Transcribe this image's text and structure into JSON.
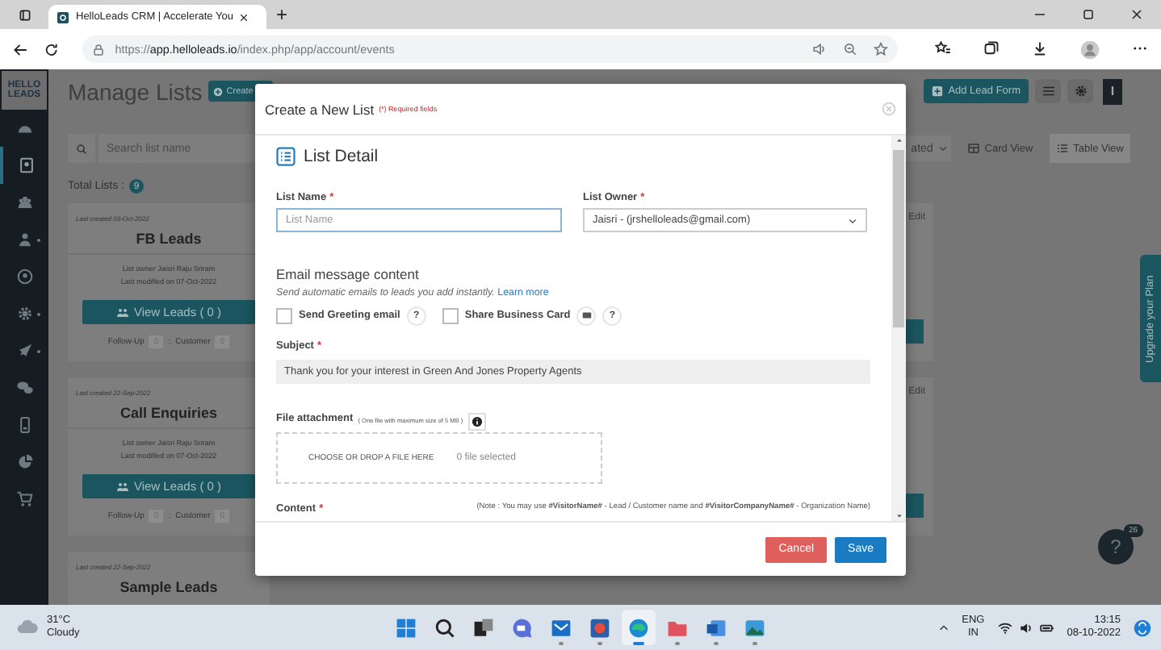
{
  "browser": {
    "tab": {
      "title": "HelloLeads CRM | Accelerate You",
      "selected": true
    },
    "new_tab": "+",
    "url": {
      "scheme": "https://",
      "host": "app.helloleads.io",
      "path": "/index.php/app/account/events"
    }
  },
  "sidebar": {
    "logo": [
      "HELLO",
      "LEADS"
    ],
    "items": [
      {
        "kind": "gauge",
        "selected": false,
        "expandable": false
      },
      {
        "kind": "contacts",
        "selected": true,
        "expandable": false
      },
      {
        "kind": "team",
        "selected": false,
        "expandable": false
      },
      {
        "kind": "user-add",
        "selected": false,
        "expandable": true
      },
      {
        "kind": "user",
        "selected": false,
        "expandable": false
      },
      {
        "kind": "gear",
        "selected": false,
        "expandable": true
      },
      {
        "kind": "rocket",
        "selected": false,
        "expandable": true
      },
      {
        "kind": "chat",
        "selected": false,
        "expandable": false
      },
      {
        "kind": "phone",
        "selected": false,
        "expandable": false
      },
      {
        "kind": "pie",
        "selected": false,
        "expandable": false
      },
      {
        "kind": "cart",
        "selected": false,
        "expandable": false
      }
    ]
  },
  "page": {
    "title": "Manage Lists",
    "create_button": "Create",
    "add_lead_form_button": "Add Lead Form",
    "user_initial": "I",
    "search": {
      "placeholder": "Search list name"
    },
    "sort": {
      "value": "ated"
    },
    "views": [
      {
        "label": "Card View",
        "kind": "card",
        "selected": false
      },
      {
        "label": "Table View",
        "kind": "table",
        "selected": true
      }
    ],
    "total_lists": {
      "label": "Total Lists :",
      "count": "9"
    },
    "cards": [
      {
        "created": "Last created 03-Oct-2022",
        "name": "FB Leads",
        "owner": "List owner Jaisri Raju Sriram",
        "modified": "Last modified on 07-Oct-2022",
        "view_button": "View Leads ( 0 )",
        "follow_up_label": "Follow-Up",
        "follow_up_count": "0",
        "separator": ":",
        "customer_label": "Customer",
        "customer_count": "0"
      },
      {
        "created": "Last created 22-Sep-2022",
        "name": "Call Enquiries",
        "owner": "List owner Jaisri Raju Sriram",
        "modified": "Last modified on 07-Oct-2022",
        "view_button": "View Leads ( 0 )",
        "follow_up_label": "Follow-Up",
        "follow_up_count": "0",
        "separator": ":",
        "customer_label": "Customer",
        "customer_count": "0"
      },
      {
        "created": "Last created 22-Sep-2022",
        "name": "Sample Leads"
      }
    ],
    "right_cards": [
      {
        "edit": "Edit"
      },
      {
        "edit": "Edit"
      }
    ],
    "upgrade_tab": "Upgrade your Plan",
    "help": {
      "label": "?",
      "badge": "26"
    }
  },
  "modal": {
    "title": "Create a New List",
    "required_note": "(*) Required fields",
    "section_title": "List Detail",
    "list_name": {
      "label": "List Name",
      "mark": "*",
      "placeholder": "List Name"
    },
    "list_owner": {
      "label": "List Owner",
      "mark": "*",
      "value": "Jaisri - (jrshelloleads@gmail.com)"
    },
    "email_heading": "Email message content",
    "email_hint": "Send automatic emails to leads you add instantly.",
    "learn_more": "Learn more",
    "options": [
      {
        "label": "Send Greeting email",
        "kind": "plain",
        "checked": false,
        "help": "?"
      },
      {
        "label": "Share Business Card",
        "kind": "card",
        "checked": false,
        "help": "?"
      }
    ],
    "subject": {
      "label": "Subject",
      "mark": "*",
      "value": "Thank you for your interest in Green And Jones Property Agents"
    },
    "attachment": {
      "label": "File attachment",
      "hint": "( One file with maximum size of 5 MB )",
      "drop_text": "CHOOSE OR DROP A FILE HERE",
      "status": "0 file selected"
    },
    "content": {
      "label": "Content",
      "mark": "*",
      "note": "(Note : You may use **#VisitorName#** - Lead / Customer name and **#VisitorCompanyName#** - Organization Name)"
    },
    "buttons": [
      {
        "label": "Cancel",
        "kind": "cancel"
      },
      {
        "label": "Save",
        "kind": "primary"
      }
    ]
  },
  "taskbar": {
    "weather": {
      "temp": "31°C",
      "condition": "Cloudy"
    },
    "apps": [
      {
        "kind": "start",
        "running": false,
        "selected": false
      },
      {
        "kind": "search",
        "running": false,
        "selected": false
      },
      {
        "kind": "task-view",
        "running": false,
        "selected": false
      },
      {
        "kind": "chat",
        "running": false,
        "selected": false
      },
      {
        "kind": "mail",
        "running": true,
        "selected": false
      },
      {
        "kind": "app",
        "running": true,
        "selected": false
      },
      {
        "kind": "browser",
        "running": true,
        "selected": true
      },
      {
        "kind": "folder",
        "running": true,
        "selected": false
      },
      {
        "kind": "word",
        "running": true,
        "selected": false
      },
      {
        "kind": "photos",
        "running": true,
        "selected": false
      }
    ],
    "language": [
      "ENG",
      "IN"
    ],
    "time": "13:15",
    "date": "08-10-2022"
  }
}
